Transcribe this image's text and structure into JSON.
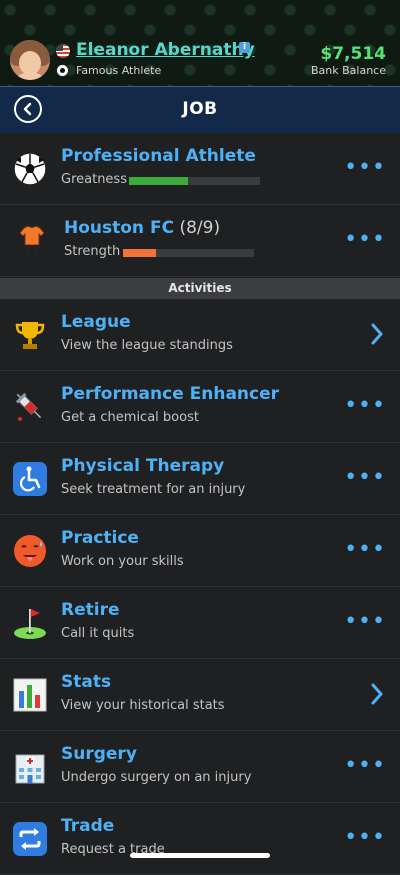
{
  "header": {
    "name": "Eleanor Abernathy",
    "occupation": "Famous Athlete",
    "balance": "$7,514",
    "balance_label": "Bank Balance",
    "info_icon": "info-icon"
  },
  "titlebar": {
    "title": "JOB",
    "back_icon": "back-arrow-icon"
  },
  "career": [
    {
      "title": "Professional Athlete",
      "suffix": "",
      "stat_label": "Greatness",
      "stat_value": 0.45,
      "stat_color": "#3cab3c",
      "icon": "soccer-ball-icon"
    },
    {
      "title": "Houston FC",
      "suffix": " (8/9)",
      "stat_label": "Strength",
      "stat_value": 0.25,
      "stat_color": "#f2733a",
      "icon": "jersey-icon"
    }
  ],
  "section_header": "Activities",
  "activities": [
    {
      "title": "League",
      "subtitle": "View the league standings",
      "icon": "trophy-icon",
      "action": "chevron"
    },
    {
      "title": "Performance Enhancer",
      "subtitle": "Get a chemical boost",
      "icon": "syringe-icon",
      "action": "dots"
    },
    {
      "title": "Physical Therapy",
      "subtitle": "Seek treatment for an injury",
      "icon": "wheelchair-icon",
      "action": "dots"
    },
    {
      "title": "Practice",
      "subtitle": "Work on your skills",
      "icon": "hot-face-icon",
      "action": "dots"
    },
    {
      "title": "Retire",
      "subtitle": "Call it quits",
      "icon": "golf-flag-icon",
      "action": "dots"
    },
    {
      "title": "Stats",
      "subtitle": "View your historical stats",
      "icon": "bar-chart-icon",
      "action": "chevron"
    },
    {
      "title": "Surgery",
      "subtitle": "Undergo surgery on an injury",
      "icon": "hospital-icon",
      "action": "dots"
    },
    {
      "title": "Trade",
      "subtitle": "Request a trade",
      "icon": "repeat-arrows-icon",
      "action": "dots"
    }
  ],
  "colors": {
    "accent": "#4eb0f5",
    "money": "#57e07a",
    "name": "#57d6c9"
  }
}
